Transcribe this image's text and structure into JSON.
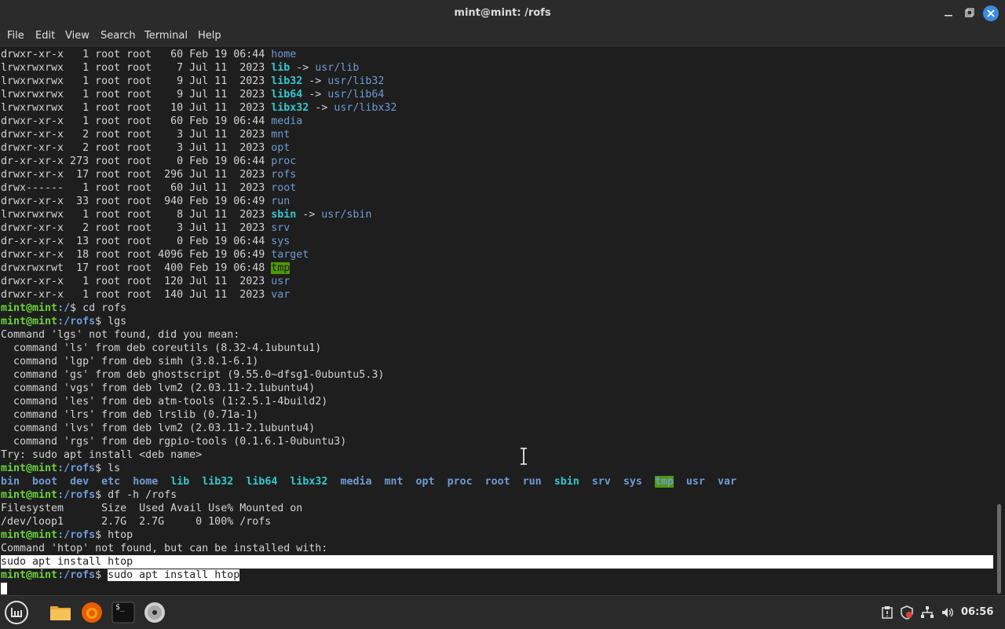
{
  "window": {
    "title": "mint@mint: /rofs"
  },
  "menu": [
    "File",
    "Edit",
    "View",
    "Search",
    "Terminal",
    "Help"
  ],
  "listing": [
    {
      "perm": "drwxr-xr-x   1 root root   60 Feb 19 06:44 ",
      "name": "home",
      "target": ""
    },
    {
      "perm": "lrwxrwxrwx   1 root root    7 Jul 11  2023 ",
      "name": "lib",
      "target": "usr/lib"
    },
    {
      "perm": "lrwxrwxrwx   1 root root    9 Jul 11  2023 ",
      "name": "lib32",
      "target": "usr/lib32"
    },
    {
      "perm": "lrwxrwxrwx   1 root root    9 Jul 11  2023 ",
      "name": "lib64",
      "target": "usr/lib64"
    },
    {
      "perm": "lrwxrwxrwx   1 root root   10 Jul 11  2023 ",
      "name": "libx32",
      "target": "usr/libx32"
    },
    {
      "perm": "drwxr-xr-x   1 root root   60 Feb 19 06:44 ",
      "name": "media",
      "target": ""
    },
    {
      "perm": "drwxr-xr-x   2 root root    3 Jul 11  2023 ",
      "name": "mnt",
      "target": ""
    },
    {
      "perm": "drwxr-xr-x   2 root root    3 Jul 11  2023 ",
      "name": "opt",
      "target": ""
    },
    {
      "perm": "dr-xr-xr-x 273 root root    0 Feb 19 06:44 ",
      "name": "proc",
      "target": ""
    },
    {
      "perm": "drwxr-xr-x  17 root root  296 Jul 11  2023 ",
      "name": "rofs",
      "target": ""
    },
    {
      "perm": "drwx------   1 root root   60 Jul 11  2023 ",
      "name": "root",
      "target": ""
    },
    {
      "perm": "drwxr-xr-x  33 root root  940 Feb 19 06:49 ",
      "name": "run",
      "target": ""
    },
    {
      "perm": "lrwxrwxrwx   1 root root    8 Jul 11  2023 ",
      "name": "sbin",
      "target": "usr/sbin"
    },
    {
      "perm": "drwxr-xr-x   2 root root    3 Jul 11  2023 ",
      "name": "srv",
      "target": ""
    },
    {
      "perm": "dr-xr-xr-x  13 root root    0 Feb 19 06:44 ",
      "name": "sys",
      "target": ""
    },
    {
      "perm": "drwxr-xr-x  18 root root 4096 Feb 19 06:49 ",
      "name": "target",
      "target": ""
    },
    {
      "perm": "drwxrwxrwt  17 root root  400 Feb 19 06:48 ",
      "name": "tmp",
      "target": ""
    },
    {
      "perm": "drwxr-xr-x   1 root root  120 Jul 11  2023 ",
      "name": "usr",
      "target": ""
    },
    {
      "perm": "drwxr-xr-x   1 root root  140 Jul 11  2023 ",
      "name": "var",
      "target": ""
    }
  ],
  "link_arrow": " -> ",
  "prompts": {
    "user": "mint@mint",
    "p1_path": ":/",
    "p1_cmd": "$ cd rofs",
    "p2_path": ":/rofs",
    "p2_cmd": "$ lgs",
    "p3_cmd": "$ ls",
    "p4_cmd": "$ df -h /rofs",
    "p5_cmd": "$ htop",
    "p6_sigil": "$ ",
    "p6_cmd": "sudo apt install htop"
  },
  "lgs_output": [
    "Command 'lgs' not found, did you mean:",
    "  command 'ls' from deb coreutils (8.32-4.1ubuntu1)",
    "  command 'lgp' from deb simh (3.8.1-6.1)",
    "  command 'gs' from deb ghostscript (9.55.0~dfsg1-0ubuntu5.3)",
    "  command 'vgs' from deb lvm2 (2.03.11-2.1ubuntu4)",
    "  command 'les' from deb atm-tools (1:2.5.1-4build2)",
    "  command 'lrs' from deb lrslib (0.71a-1)",
    "  command 'lvs' from deb lvm2 (2.03.11-2.1ubuntu4)",
    "  command 'rgs' from deb rgpio-tools (0.1.6.1-0ubuntu3)",
    "Try: sudo apt install <deb name>"
  ],
  "ls_output": [
    "bin",
    "boot",
    "dev",
    "etc",
    "home",
    "lib",
    "lib32",
    "lib64",
    "libx32",
    "media",
    "mnt",
    "opt",
    "proc",
    "root",
    "run",
    "sbin",
    "srv",
    "sys",
    "tmp",
    "usr",
    "var"
  ],
  "df_output": [
    "Filesystem      Size  Used Avail Use% Mounted on",
    "/dev/loop1      2.7G  2.7G     0 100% /rofs"
  ],
  "htop_output": [
    "Command 'htop' not found, but can be installed with:",
    "sudo apt install htop"
  ],
  "taskbar": {
    "clock": "06:56",
    "terminal_glyph": "$_"
  }
}
